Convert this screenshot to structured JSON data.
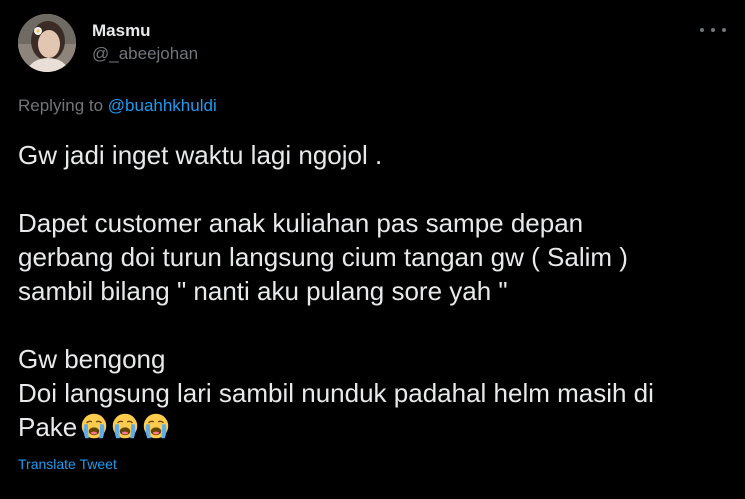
{
  "tweet": {
    "author": {
      "display_name": "Masmu",
      "handle": "@_abeejohan"
    },
    "reply": {
      "prefix": "Replying to ",
      "mention": "@buahhkhuldi"
    },
    "text_lines": [
      "Gw jadi inget waktu lagi ngojol .",
      "",
      "Dapet customer anak kuliahan pas sampe depan",
      "gerbang doi turun langsung cium tangan gw ( Salim )",
      "sambil bilang \" nanti aku pulang sore yah \"",
      "",
      "Gw bengong",
      "Doi langsung lari sambil nunduk padahal helm masih di",
      "Pake"
    ],
    "emojis": [
      "loudly-crying-face-icon",
      "loudly-crying-face-icon",
      "loudly-crying-face-icon"
    ],
    "translate_label": "Translate Tweet"
  },
  "colors": {
    "background": "#000000",
    "text_primary": "#e7e9ea",
    "text_secondary": "#71767b",
    "accent": "#1d9bf0"
  }
}
